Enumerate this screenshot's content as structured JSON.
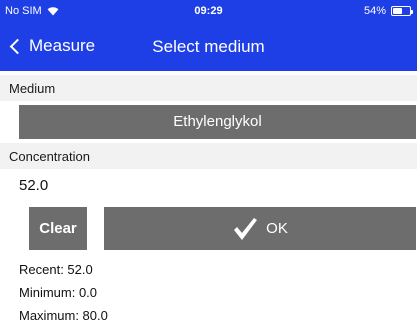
{
  "status_bar": {
    "carrier": "No SIM",
    "time": "09:29",
    "battery_percent_text": "54%",
    "battery_level": 0.54
  },
  "nav": {
    "back_label": "Measure",
    "title": "Select medium"
  },
  "medium_section": {
    "header": "Medium",
    "selected_value": "Ethylenglykol"
  },
  "concentration_section": {
    "header": "Concentration",
    "value": "52.0"
  },
  "buttons": {
    "clear_label": "Clear",
    "ok_label": "OK"
  },
  "info": {
    "recent": "Recent: 52.0",
    "minimum": "Minimum: 0.0",
    "maximum": "Maximum: 80.0"
  },
  "colors": {
    "bar": "#1f3fe6",
    "button": "#6d6d6d",
    "section": "#f2f2f2"
  }
}
